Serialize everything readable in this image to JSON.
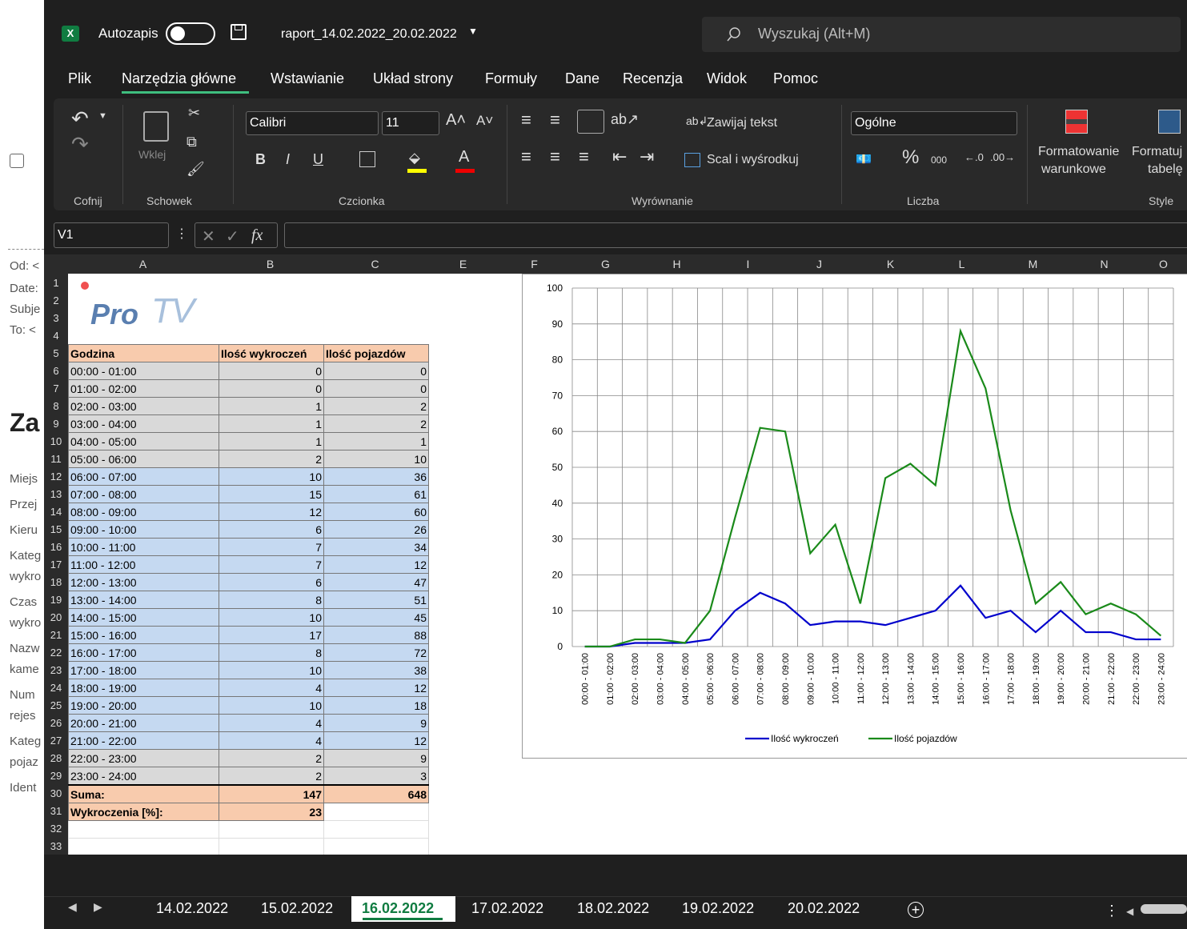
{
  "background_email": {
    "labels": [
      "Od: <",
      "Date:",
      "Subje",
      "To: <",
      "Za",
      "Miejs",
      "Przej",
      "Kieru",
      "Kateg",
      "wykro",
      "Czas",
      "wykro",
      "Nazw",
      "kame",
      "Num",
      "rejes",
      "Kateg",
      "pojaz",
      "Ident"
    ]
  },
  "titlebar": {
    "autosave_label": "Autozapis",
    "filename": "raport_14.02.2022_20.02.2022",
    "search_placeholder": "Wyszukaj (Alt+M)",
    "app_icon": "X"
  },
  "menu": [
    "Plik",
    "Narzędzia główne",
    "Wstawianie",
    "Układ strony",
    "Formuły",
    "Dane",
    "Recenzja",
    "Widok",
    "Pomoc"
  ],
  "menu_active_index": 1,
  "ribbon": {
    "undo_group": "Cofnij",
    "clipboard_group": "Schowek",
    "paste_label": "Wklej",
    "font_group": "Czcionka",
    "font_name": "Calibri",
    "font_size": "11",
    "bold": "B",
    "italic": "I",
    "underline": "U",
    "alignment_group": "Wyrównanie",
    "wrap_text": "Zawijaj tekst",
    "merge_center": "Scal i wyśrodkuj",
    "number_group": "Liczba",
    "number_format": "Ogólne",
    "percent": "%",
    "thousands": "000",
    "styles_group": "Style",
    "conditional_format": "Formatowanie",
    "conditional_format_2": "warunkowe",
    "format_table": "Formatuj",
    "format_table_2": "tabelę"
  },
  "formula_bar": {
    "name_box": "V1",
    "fx": "fx",
    "formula": ""
  },
  "columns": [
    "A",
    "B",
    "C",
    "E",
    "F",
    "G",
    "H",
    "I",
    "J",
    "K",
    "L",
    "M",
    "N",
    "O"
  ],
  "rows": [
    "1",
    "2",
    "3",
    "4",
    "5",
    "6",
    "7",
    "8",
    "9",
    "10",
    "11",
    "12",
    "13",
    "14",
    "15",
    "16",
    "17",
    "18",
    "19",
    "20",
    "21",
    "22",
    "23",
    "24",
    "25",
    "26",
    "27",
    "28",
    "29",
    "30",
    "31",
    "32",
    "33"
  ],
  "logo_text": "Pro",
  "logo_text_tv": "TV",
  "table": {
    "headers": [
      "Godzina",
      "Ilość wykroczeń",
      "Ilość pojazdów"
    ],
    "rows": [
      {
        "hour": "00:00 - 01:00",
        "v": "0",
        "p": "0",
        "style": "gr"
      },
      {
        "hour": "01:00 - 02:00",
        "v": "0",
        "p": "0",
        "style": "gr"
      },
      {
        "hour": "02:00 - 03:00",
        "v": "1",
        "p": "2",
        "style": "gr"
      },
      {
        "hour": "03:00 - 04:00",
        "v": "1",
        "p": "2",
        "style": "gr"
      },
      {
        "hour": "04:00 - 05:00",
        "v": "1",
        "p": "1",
        "style": "gr"
      },
      {
        "hour": "05:00 - 06:00",
        "v": "2",
        "p": "10",
        "style": "gr"
      },
      {
        "hour": "06:00 - 07:00",
        "v": "10",
        "p": "36",
        "style": "bl"
      },
      {
        "hour": "07:00 - 08:00",
        "v": "15",
        "p": "61",
        "style": "bl"
      },
      {
        "hour": "08:00 - 09:00",
        "v": "12",
        "p": "60",
        "style": "bl"
      },
      {
        "hour": "09:00 - 10:00",
        "v": "6",
        "p": "26",
        "style": "bl"
      },
      {
        "hour": "10:00 - 11:00",
        "v": "7",
        "p": "34",
        "style": "bl"
      },
      {
        "hour": "11:00 - 12:00",
        "v": "7",
        "p": "12",
        "style": "bl"
      },
      {
        "hour": "12:00 - 13:00",
        "v": "6",
        "p": "47",
        "style": "bl"
      },
      {
        "hour": "13:00 - 14:00",
        "v": "8",
        "p": "51",
        "style": "bl"
      },
      {
        "hour": "14:00 - 15:00",
        "v": "10",
        "p": "45",
        "style": "bl"
      },
      {
        "hour": "15:00 - 16:00",
        "v": "17",
        "p": "88",
        "style": "bl"
      },
      {
        "hour": "16:00 - 17:00",
        "v": "8",
        "p": "72",
        "style": "bl"
      },
      {
        "hour": "17:00 - 18:00",
        "v": "10",
        "p": "38",
        "style": "bl"
      },
      {
        "hour": "18:00 - 19:00",
        "v": "4",
        "p": "12",
        "style": "bl"
      },
      {
        "hour": "19:00 - 20:00",
        "v": "10",
        "p": "18",
        "style": "bl"
      },
      {
        "hour": "20:00 - 21:00",
        "v": "4",
        "p": "9",
        "style": "bl"
      },
      {
        "hour": "21:00 - 22:00",
        "v": "4",
        "p": "12",
        "style": "bl"
      },
      {
        "hour": "22:00 - 23:00",
        "v": "2",
        "p": "9",
        "style": "gr"
      },
      {
        "hour": "23:00 - 24:00",
        "v": "2",
        "p": "3",
        "style": "gr"
      }
    ],
    "sum_label": "Suma:",
    "sum_v": "147",
    "sum_p": "648",
    "pct_label": "Wykroczenia [%]:",
    "pct_value": "23"
  },
  "chart_data": {
    "type": "line",
    "categories": [
      "00:00 - 01:00",
      "01:00 - 02:00",
      "02:00 - 03:00",
      "03:00 - 04:00",
      "04:00 - 05:00",
      "05:00 - 06:00",
      "06:00 - 07:00",
      "07:00 - 08:00",
      "08:00 - 09:00",
      "09:00 - 10:00",
      "10:00 - 11:00",
      "11:00 - 12:00",
      "12:00 - 13:00",
      "13:00 - 14:00",
      "14:00 - 15:00",
      "15:00 - 16:00",
      "16:00 - 17:00",
      "17:00 - 18:00",
      "18:00 - 19:00",
      "19:00 - 20:00",
      "20:00 - 21:00",
      "21:00 - 22:00",
      "22:00 - 23:00",
      "23:00 - 24:00"
    ],
    "series": [
      {
        "name": "Ilość wykroczeń",
        "color": "#0000cc",
        "values": [
          0,
          0,
          1,
          1,
          1,
          2,
          10,
          15,
          12,
          6,
          7,
          7,
          6,
          8,
          10,
          17,
          8,
          10,
          4,
          10,
          4,
          4,
          2,
          2
        ]
      },
      {
        "name": "Ilość pojazdów",
        "color": "#1a8a1a",
        "values": [
          0,
          0,
          2,
          2,
          1,
          10,
          36,
          61,
          60,
          26,
          34,
          12,
          47,
          51,
          45,
          88,
          72,
          38,
          12,
          18,
          9,
          12,
          9,
          3
        ]
      }
    ],
    "yticks": [
      "0",
      "10",
      "20",
      "30",
      "40",
      "50",
      "60",
      "70",
      "80",
      "90",
      "100"
    ],
    "ylim": [
      0,
      100
    ],
    "grid": true,
    "legend": "bottom"
  },
  "tabs": [
    "14.02.2022",
    "15.02.2022",
    "16.02.2022",
    "17.02.2022",
    "18.02.2022",
    "19.02.2022",
    "20.02.2022"
  ],
  "active_tab": 2
}
